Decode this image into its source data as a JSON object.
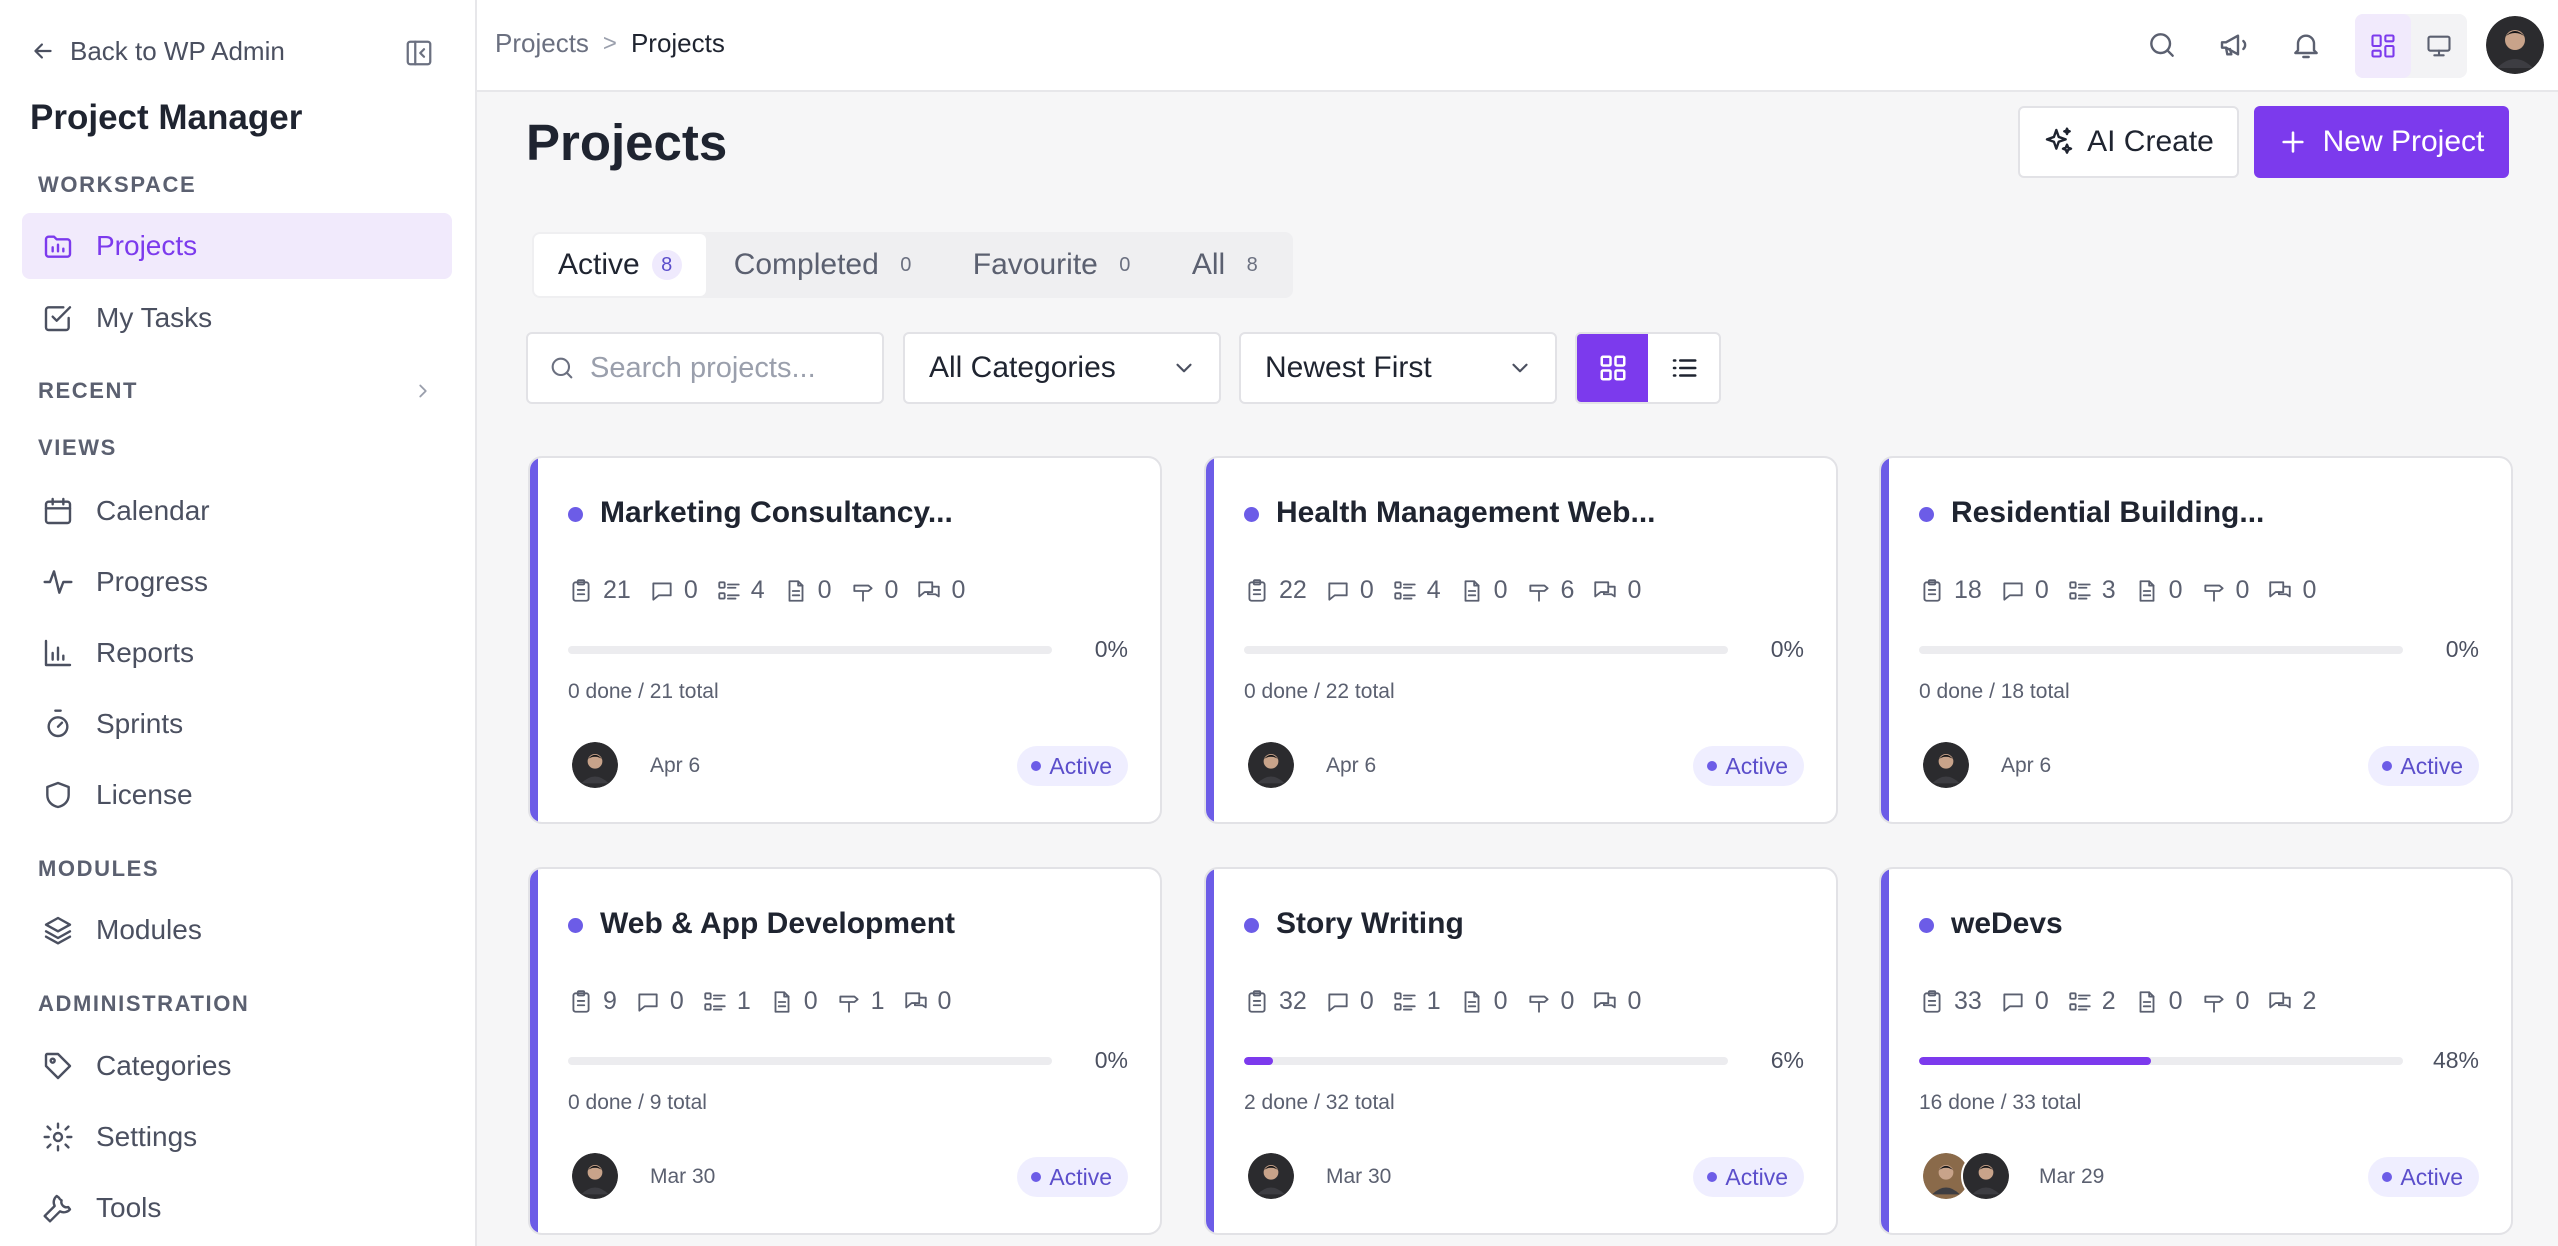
{
  "sidebar": {
    "back_label": "Back to WP Admin",
    "app_title": "Project Manager",
    "sections": {
      "workspace": "WORKSPACE",
      "recent": "RECENT",
      "views": "VIEWS",
      "modules": "MODULES",
      "administration": "ADMINISTRATION"
    },
    "items": {
      "projects": "Projects",
      "my_tasks": "My Tasks",
      "calendar": "Calendar",
      "progress": "Progress",
      "reports": "Reports",
      "sprints": "Sprints",
      "license": "License",
      "modules": "Modules",
      "categories": "Categories",
      "settings": "Settings",
      "tools": "Tools"
    }
  },
  "topbar": {
    "breadcrumb_parent": "Projects",
    "breadcrumb_separator": ">",
    "breadcrumb_current": "Projects"
  },
  "main": {
    "title": "Projects",
    "ai_create_label": "AI Create",
    "new_project_label": "New Project",
    "tabs": [
      {
        "label": "Active",
        "count": "8"
      },
      {
        "label": "Completed",
        "count": "0"
      },
      {
        "label": "Favourite",
        "count": "0"
      },
      {
        "label": "All",
        "count": "8"
      }
    ],
    "search_placeholder": "Search projects...",
    "category_filter": "All Categories",
    "sort_filter": "Newest First"
  },
  "colors": {
    "accent": "#7c3aed",
    "card_stripe": "#6c5ce7",
    "badge_bg": "#efeeff",
    "active_nav_bg": "#f1eafc"
  },
  "icons": {
    "stats": [
      "clipboard-icon",
      "comment-icon",
      "list-icon",
      "file-icon",
      "milestone-icon",
      "discussion-icon"
    ]
  },
  "projects": [
    {
      "title": "Marketing Consultancy...",
      "stats": [
        "21",
        "0",
        "4",
        "0",
        "0",
        "0"
      ],
      "progress": 0,
      "percent": "0%",
      "done_label": "0 done / 21 total",
      "date": "Apr 6",
      "status": "Active",
      "members": 1
    },
    {
      "title": "Health Management Web...",
      "stats": [
        "22",
        "0",
        "4",
        "0",
        "6",
        "0"
      ],
      "progress": 0,
      "percent": "0%",
      "done_label": "0 done / 22 total",
      "date": "Apr 6",
      "status": "Active",
      "members": 1
    },
    {
      "title": "Residential Building...",
      "stats": [
        "18",
        "0",
        "3",
        "0",
        "0",
        "0"
      ],
      "progress": 0,
      "percent": "0%",
      "done_label": "0 done / 18 total",
      "date": "Apr 6",
      "status": "Active",
      "members": 1
    },
    {
      "title": "Web & App Development",
      "stats": [
        "9",
        "0",
        "1",
        "0",
        "1",
        "0"
      ],
      "progress": 0,
      "percent": "0%",
      "done_label": "0 done / 9 total",
      "date": "Mar 30",
      "status": "Active",
      "members": 1
    },
    {
      "title": "Story Writing",
      "stats": [
        "32",
        "0",
        "1",
        "0",
        "0",
        "0"
      ],
      "progress": 6,
      "percent": "6%",
      "done_label": "2 done / 32 total",
      "date": "Mar 30",
      "status": "Active",
      "members": 1
    },
    {
      "title": "weDevs",
      "stats": [
        "33",
        "0",
        "2",
        "0",
        "0",
        "2"
      ],
      "progress": 48,
      "percent": "48%",
      "done_label": "16 done / 33 total",
      "date": "Mar 29",
      "status": "Active",
      "members": 2
    }
  ]
}
